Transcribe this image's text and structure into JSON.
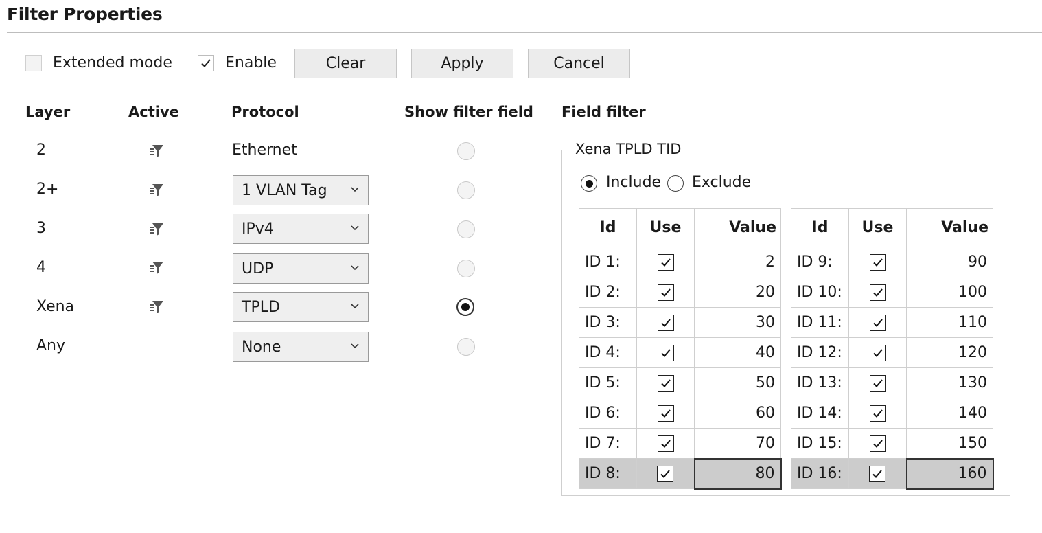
{
  "title": "Filter Properties",
  "toolbar": {
    "extended_mode_label": "Extended mode",
    "extended_mode_checked": false,
    "enable_label": "Enable",
    "enable_checked": true,
    "clear_label": "Clear",
    "apply_label": "Apply",
    "cancel_label": "Cancel"
  },
  "headers": {
    "layer": "Layer",
    "active": "Active",
    "protocol": "Protocol",
    "show_filter_field": "Show filter field",
    "field_filter": "Field filter"
  },
  "layers": [
    {
      "layer": "2",
      "active_icon": "filter-icon",
      "protocol": "Ethernet",
      "protocol_is_dropdown": false,
      "show_filter_selected": false
    },
    {
      "layer": "2+",
      "active_icon": "filter-icon",
      "protocol": "1 VLAN Tag",
      "protocol_is_dropdown": true,
      "show_filter_selected": false
    },
    {
      "layer": "3",
      "active_icon": "filter-icon",
      "protocol": "IPv4",
      "protocol_is_dropdown": true,
      "show_filter_selected": false
    },
    {
      "layer": "4",
      "active_icon": "filter-icon",
      "protocol": "UDP",
      "protocol_is_dropdown": true,
      "show_filter_selected": false
    },
    {
      "layer": "Xena",
      "active_icon": "filter-icon",
      "protocol": "TPLD",
      "protocol_is_dropdown": true,
      "show_filter_selected": true
    },
    {
      "layer": "Any",
      "active_icon": "",
      "protocol": "None",
      "protocol_is_dropdown": true,
      "show_filter_selected": false
    }
  ],
  "field_filter": {
    "group_title": "Xena TPLD TID",
    "include_label": "Include",
    "exclude_label": "Exclude",
    "mode": "Include",
    "columns": {
      "id": "Id",
      "use": "Use",
      "value": "Value"
    },
    "left_table": [
      {
        "id": "ID 1:",
        "use": true,
        "value": "2"
      },
      {
        "id": "ID 2:",
        "use": true,
        "value": "20"
      },
      {
        "id": "ID 3:",
        "use": true,
        "value": "30"
      },
      {
        "id": "ID 4:",
        "use": true,
        "value": "40"
      },
      {
        "id": "ID 5:",
        "use": true,
        "value": "50"
      },
      {
        "id": "ID 6:",
        "use": true,
        "value": "60"
      },
      {
        "id": "ID 7:",
        "use": true,
        "value": "70"
      },
      {
        "id": "ID 8:",
        "use": true,
        "value": "80"
      }
    ],
    "right_table": [
      {
        "id": "ID 9:",
        "use": true,
        "value": "90"
      },
      {
        "id": "ID 10:",
        "use": true,
        "value": "100"
      },
      {
        "id": "ID 11:",
        "use": true,
        "value": "110"
      },
      {
        "id": "ID 12:",
        "use": true,
        "value": "120"
      },
      {
        "id": "ID 13:",
        "use": true,
        "value": "130"
      },
      {
        "id": "ID 14:",
        "use": true,
        "value": "140"
      },
      {
        "id": "ID 15:",
        "use": true,
        "value": "150"
      },
      {
        "id": "ID 16:",
        "use": true,
        "value": "160"
      }
    ]
  },
  "colors": {
    "selected_row": "#cccccc",
    "border": "#cfcfcf",
    "button_bg": "#ececec"
  }
}
